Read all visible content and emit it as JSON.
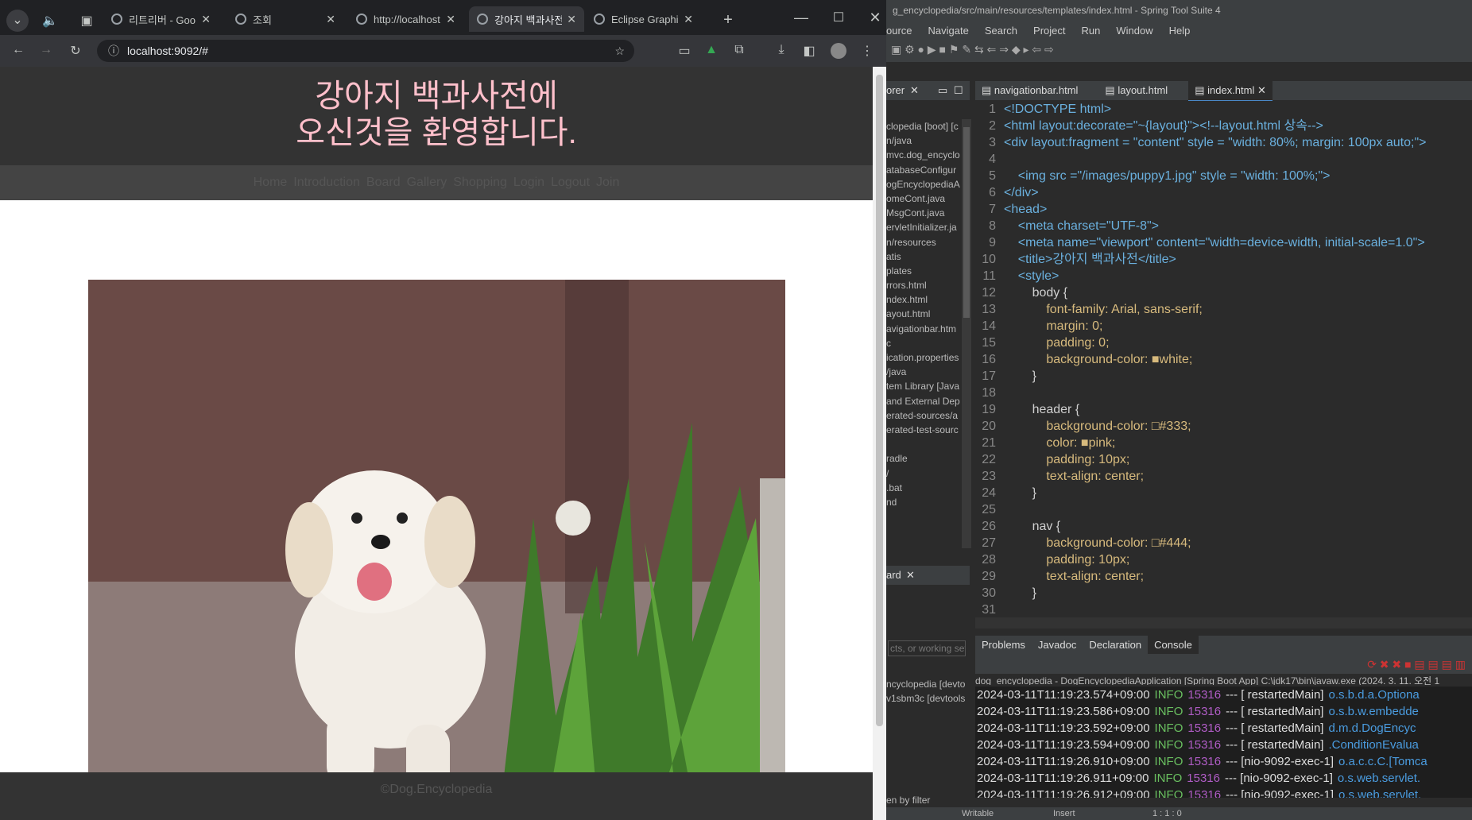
{
  "browser": {
    "tabs": [
      {
        "label": "리트리버 - Goo",
        "active": false
      },
      {
        "label": "조회",
        "active": false
      },
      {
        "label": "http://localhost",
        "active": false
      },
      {
        "label": "강아지 백과사전",
        "active": true
      },
      {
        "label": "Eclipse Graphi",
        "active": false
      }
    ],
    "url": "localhost:9092/#"
  },
  "page": {
    "title_line1": "강아지 백과사전에",
    "title_line2": "오신것을 환영합니다.",
    "nav": [
      "Home",
      "Introduction",
      "Board",
      "Gallery",
      "Shopping",
      "Login",
      "Logout",
      "Join"
    ],
    "footer": "©Dog.Encyclopedia",
    "image_alt": "puppy"
  },
  "ide": {
    "title": "g_encyclopedia/src/main/resources/templates/index.html - Spring Tool Suite 4",
    "menu": [
      "ource",
      "Navigate",
      "Search",
      "Project",
      "Run",
      "Window",
      "Help"
    ],
    "editor_tabs": [
      "navigationbar.html",
      "layout.html",
      "index.html"
    ],
    "explorer_label": "orer",
    "explorer_items": [
      "clopedia [boot] [c",
      "n/java",
      "mvc.dog_encyclo",
      "atabaseConfigur",
      "ogEncyclopediaA",
      "omeCont.java",
      "MsgCont.java",
      "ervletInitializer.ja",
      "n/resources",
      "atis",
      "plates",
      "rrors.html",
      "ndex.html",
      "ayout.html",
      "avigationbar.htm",
      "c",
      "ication.properties",
      "/java",
      "tem Library [Java",
      "and External Dep",
      "erated-sources/a",
      "erated-test-sourc",
      " ",
      "radle",
      "/",
      ".bat",
      "nd"
    ],
    "board_label": "ard",
    "board_filter": "cts, or working set",
    "board_items": [
      "ncyclopedia [devto",
      "v1sbm3c [devtools"
    ],
    "board_footer": "en by filter",
    "code": [
      "<!DOCTYPE html>",
      "<html layout:decorate=\"~{layout}\"><!--layout.html 상속-->",
      "<div layout:fragment = \"content\" style = \"width: 80%; margin: 100px auto;\">",
      "",
      "    <img src =\"/images/puppy1.jpg\" style = \"width: 100%;\">",
      "</div>",
      "<head>",
      "    <meta charset=\"UTF-8\">",
      "    <meta name=\"viewport\" content=\"width=device-width, initial-scale=1.0\">",
      "    <title>강아지 백과사전</title>",
      "    <style>",
      "        body {",
      "            font-family: Arial, sans-serif;",
      "            margin: 0;",
      "            padding: 0;",
      "            background-color: ■white;",
      "        }",
      "",
      "        header {",
      "            background-color: □#333;",
      "            color: ■pink;",
      "            padding: 10px;",
      "            text-align: center;",
      "        }",
      "",
      "        nav {",
      "            background-color: □#444;",
      "            padding: 10px;",
      "            text-align: center;",
      "        }",
      ""
    ],
    "bottom_tabs": [
      "Problems",
      "Javadoc",
      "Declaration",
      "Console"
    ],
    "console_header": "dog_encyclopedia - DogEncyclopediaApplication [Spring Boot App] C:\\jdk17\\bin\\javaw.exe  (2024. 3. 11. 오전 1",
    "console_lines": [
      {
        "ts": "2024-03-11T11:19:23.574+09:00",
        "lvl": "INFO",
        "pid": "15316",
        "th": "---  [  restartedMain]",
        "cls": "o.s.b.d.a.Optiona"
      },
      {
        "ts": "2024-03-11T11:19:23.586+09:00",
        "lvl": "INFO",
        "pid": "15316",
        "th": "---  [  restartedMain]",
        "cls": "o.s.b.w.embedde"
      },
      {
        "ts": "2024-03-11T11:19:23.592+09:00",
        "lvl": "INFO",
        "pid": "15316",
        "th": "---  [  restartedMain]",
        "cls": "d.m.d.DogEncyc"
      },
      {
        "ts": "2024-03-11T11:19:23.594+09:00",
        "lvl": "INFO",
        "pid": "15316",
        "th": "---  [  restartedMain]",
        "cls": ".ConditionEvalua"
      },
      {
        "ts": "2024-03-11T11:19:26.910+09:00",
        "lvl": "INFO",
        "pid": "15316",
        "th": "--- [nio-9092-exec-1]",
        "cls": "o.a.c.c.C.[Tomca"
      },
      {
        "ts": "2024-03-11T11:19:26.911+09:00",
        "lvl": "INFO",
        "pid": "15316",
        "th": "--- [nio-9092-exec-1]",
        "cls": "o.s.web.servlet."
      },
      {
        "ts": "2024-03-11T11:19:26.912+09:00",
        "lvl": "INFO",
        "pid": "15316",
        "th": "--- [nio-9092-exec-1]",
        "cls": "o.s.web.servlet."
      }
    ],
    "status": [
      "Writable",
      "Insert",
      "1 : 1 : 0"
    ]
  }
}
